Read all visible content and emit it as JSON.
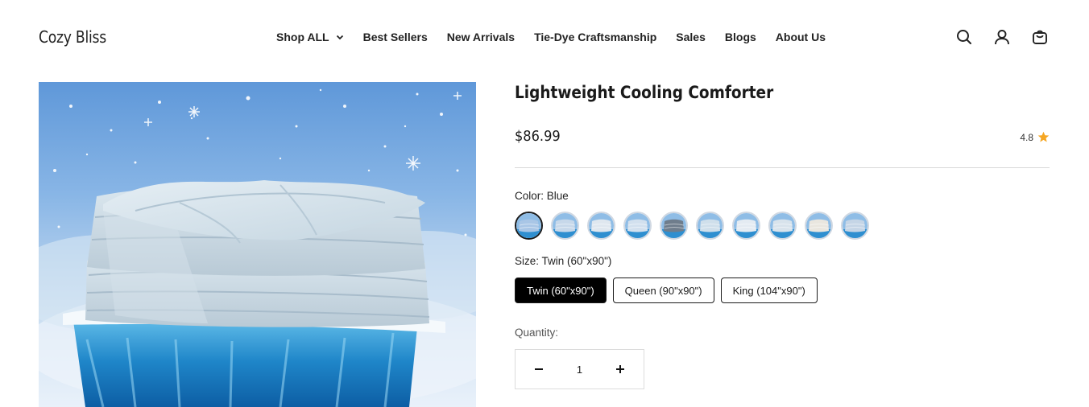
{
  "brand": {
    "logo_text": "Cozy Bliss"
  },
  "nav": {
    "items": [
      {
        "label": "Shop ALL",
        "has_dropdown": true
      },
      {
        "label": "Best Sellers"
      },
      {
        "label": "New Arrivals"
      },
      {
        "label": "Tie-Dye Craftsmanship"
      },
      {
        "label": "Sales"
      },
      {
        "label": "Blogs"
      },
      {
        "label": "About Us"
      }
    ],
    "icons": [
      "search-icon",
      "account-icon",
      "cart-icon"
    ]
  },
  "product": {
    "title": "Lightweight Cooling Comforter",
    "price": "$86.99",
    "rating": "4.8",
    "rating_icon": "star-icon",
    "star_color": "#f5a623",
    "color_label": "Color: Blue",
    "color_swatch_count": 10,
    "selected_color_index": 0,
    "size_label": "Size: Twin (60\"x90\")",
    "sizes": [
      {
        "label": "Twin (60\"x90\")",
        "selected": true
      },
      {
        "label": "Queen (90\"x90\")",
        "selected": false
      },
      {
        "label": "King (104\"x90\")",
        "selected": false
      }
    ],
    "quantity_label": "Quantity:",
    "quantity": "1"
  }
}
